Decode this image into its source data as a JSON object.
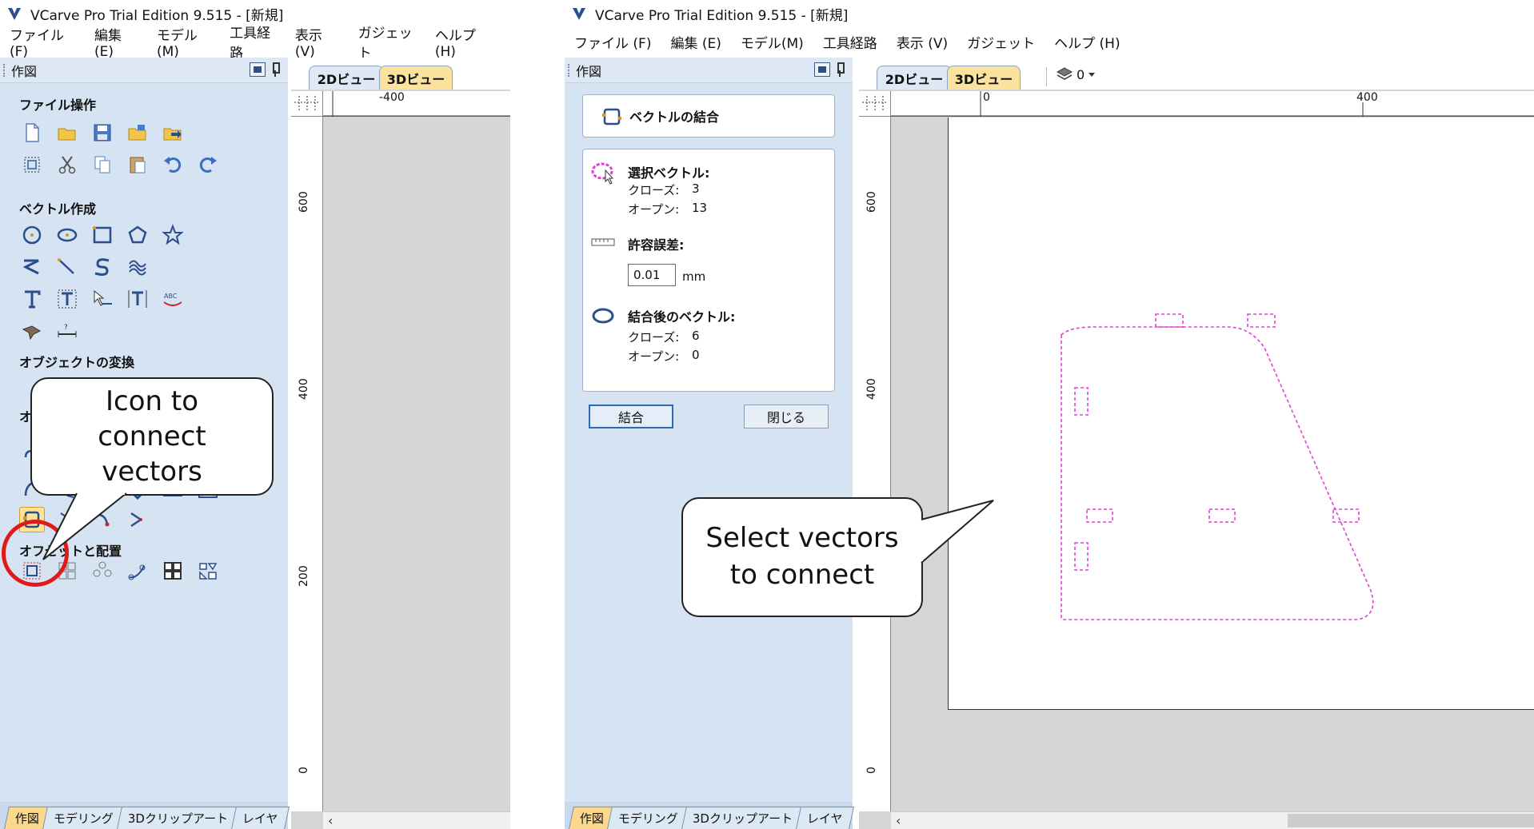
{
  "left_window": {
    "title": "VCarve Pro Trial Edition 9.515 - [新規]",
    "menu": [
      "ファイル (F)",
      "編集 (E)",
      "モデル(M)",
      "工具経路",
      "表示 (V)",
      "ガジェット",
      "ヘルプ (H)"
    ],
    "panel_title": "作図",
    "sections": {
      "file_ops": "ファイル操作",
      "vector_create": "ベクトル作成",
      "object_transform": "オブジェクトの変換",
      "offset_layout": "オフセットと配置",
      "partial_o": "オ"
    },
    "view_tabs": [
      "2Dビュー",
      "3Dビュー"
    ],
    "bottom_tabs": [
      "作図",
      "モデリング",
      "3Dクリップアート",
      "レイヤ"
    ],
    "ruler_top_label": "-400",
    "ruler_left_labels": [
      "600",
      "400",
      "200",
      "0"
    ]
  },
  "right_window": {
    "title": "VCarve Pro Trial Edition 9.515 - [新規]",
    "menu": [
      "ファイル (F)",
      "編集 (E)",
      "モデル(M)",
      "工具経路",
      "表示 (V)",
      "ガジェット",
      "ヘルプ (H)"
    ],
    "panel_title": "作図",
    "dialog_title": "ベクトルの結合",
    "selected_vectors_label": "選択ベクトル:",
    "closed_label": "クローズ:",
    "open_label": "オープン:",
    "selected_closed": "3",
    "selected_open": "13",
    "tolerance_label": "許容誤差:",
    "tolerance_value": "0.01",
    "tolerance_unit": "mm",
    "result_label": "結合後のベクトル:",
    "result_closed": "6",
    "result_open": "0",
    "join_button": "結合",
    "close_button": "閉じる",
    "view_tabs": [
      "2Dビュー",
      "3Dビュー"
    ],
    "layer_value": "0",
    "bottom_tabs": [
      "作図",
      "モデリング",
      "3Dクリップアート",
      "レイヤ"
    ],
    "ruler_top_labels": [
      "0",
      "400"
    ],
    "ruler_left_labels": [
      "600",
      "400",
      "0"
    ]
  },
  "annotations": {
    "callout_left": [
      "Icon to",
      "connect",
      "vectors"
    ],
    "callout_right": [
      "Select vectors",
      "to connect"
    ]
  },
  "colors": {
    "panel_bg": "#d5e3f2",
    "vector_dashed": "#e040d8",
    "highlight_circle": "#e01919",
    "tab_active": "#fbd88d"
  }
}
